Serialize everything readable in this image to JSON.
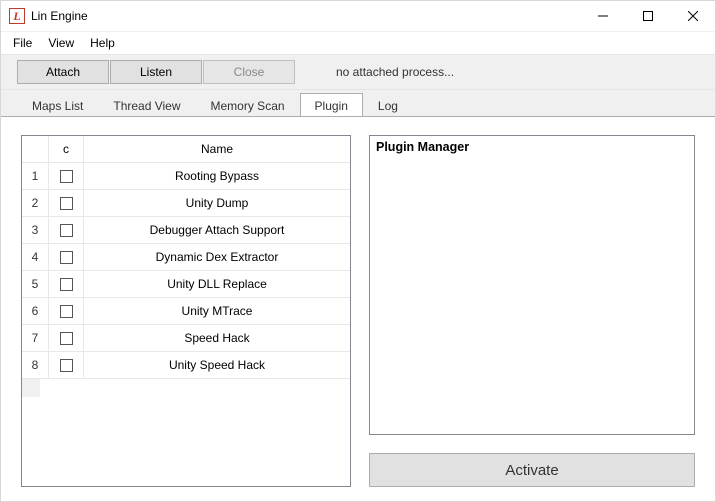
{
  "window": {
    "title": "Lin Engine",
    "icon_letter": "L"
  },
  "menu": {
    "file": "File",
    "view": "View",
    "help": "Help"
  },
  "toolbar": {
    "attach": "Attach",
    "listen": "Listen",
    "close": "Close",
    "status": "no attached process..."
  },
  "tabs": {
    "maps": "Maps List",
    "threads": "Thread View",
    "memscan": "Memory Scan",
    "plugin": "Plugin",
    "log": "Log"
  },
  "plugin_table": {
    "col_c": "c",
    "col_name": "Name",
    "rows": [
      {
        "idx": "1",
        "name": "Rooting Bypass"
      },
      {
        "idx": "2",
        "name": "Unity Dump"
      },
      {
        "idx": "3",
        "name": "Debugger Attach Support"
      },
      {
        "idx": "4",
        "name": "Dynamic Dex Extractor"
      },
      {
        "idx": "5",
        "name": "Unity DLL Replace"
      },
      {
        "idx": "6",
        "name": "Unity MTrace"
      },
      {
        "idx": "7",
        "name": "Speed Hack"
      },
      {
        "idx": "8",
        "name": "Unity Speed Hack"
      }
    ]
  },
  "detail": {
    "title": "Plugin Manager"
  },
  "activate": "Activate"
}
